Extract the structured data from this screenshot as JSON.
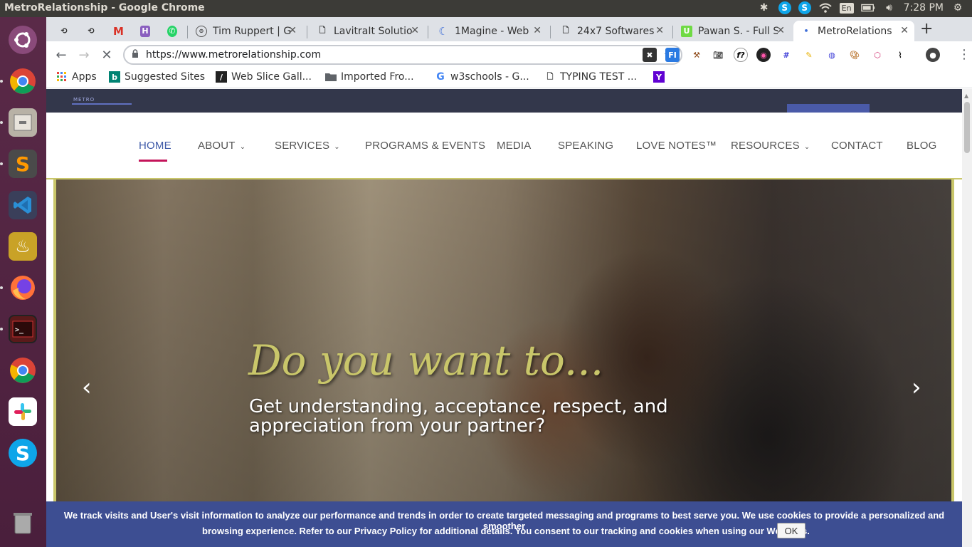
{
  "os": {
    "window_title": "MetroRelationship - Google Chrome",
    "keyboard_layout": "En",
    "clock": "7:28 PM"
  },
  "tabs": [
    {
      "label": "",
      "icon": "gitkraken-icon"
    },
    {
      "label": "",
      "icon": "gitkraken-icon"
    },
    {
      "label": "",
      "icon": "gmail-icon"
    },
    {
      "label": "",
      "icon": "habitica-icon"
    },
    {
      "label": "",
      "icon": "whatsapp-icon"
    },
    {
      "label": "Tim Ruppert | G",
      "icon": "site-icon"
    },
    {
      "label": "LavitraIt Solutio",
      "icon": "page-icon"
    },
    {
      "label": "1Magine - Web",
      "icon": "crescent-icon"
    },
    {
      "label": "24x7 Softwares",
      "icon": "page-icon"
    },
    {
      "label": "Pawan S. - Full S",
      "icon": "upwork-icon"
    },
    {
      "label": "MetroRelations",
      "icon": "loading-icon",
      "active": true
    }
  ],
  "toolbar": {
    "url": "https://www.metrorelationship.com"
  },
  "bookmarks": [
    {
      "label": "Apps",
      "icon": "apps-grid-icon"
    },
    {
      "label": "Suggested Sites",
      "icon": "bing-icon"
    },
    {
      "label": "Web Slice Gall...",
      "icon": "webslice-icon"
    },
    {
      "label": "Imported Fro...",
      "icon": "folder-icon"
    },
    {
      "label": "w3schools - G...",
      "icon": "google-icon"
    },
    {
      "label": "TYPING TEST ...",
      "icon": "page-icon"
    },
    {
      "label": "",
      "icon": "yahoo-icon"
    }
  ],
  "site": {
    "logo_text": "METRO",
    "nav": [
      {
        "label": "HOME",
        "active": true
      },
      {
        "label": "ABOUT",
        "dropdown": true
      },
      {
        "label": "SERVICES",
        "dropdown": true
      },
      {
        "label": "PROGRAMS & EVENTS"
      },
      {
        "label": "MEDIA"
      },
      {
        "label": "SPEAKING"
      },
      {
        "label": "LOVE NOTES™"
      },
      {
        "label": "RESOURCES",
        "dropdown": true
      },
      {
        "label": "CONTACT"
      },
      {
        "label": "BLOG"
      }
    ],
    "hero": {
      "script_heading": "Do you want to...",
      "subtext": "Get understanding, acceptance, respect, and appreciation from your partner?"
    },
    "cookie": {
      "line1": "We track visits and User's visit information to analyze our performance and trends in order to create targeted messaging and programs to best serve you. We use cookies to provide a personalized and smoother",
      "line2": "browsing experience. Refer to our Privacy Policy for additional details. You consent to our tracking and cookies when using our Websites.",
      "ok_label": "OK"
    }
  },
  "colors": {
    "accent_gold": "#c9c66a",
    "nav_active": "#3f5aa8",
    "underline": "#c4145a",
    "cookie_bg": "#3d4e92"
  }
}
